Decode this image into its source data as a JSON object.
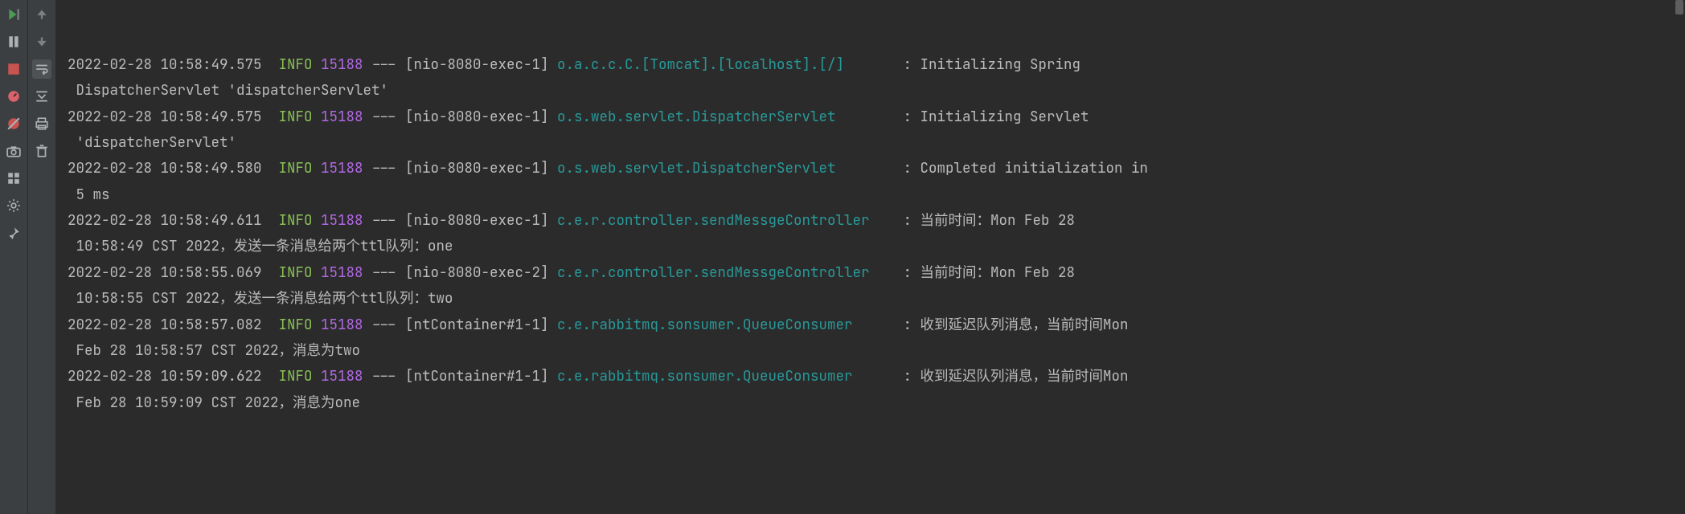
{
  "toolbar_left": {
    "resume": "resume",
    "pause": "pause",
    "stop": "stop",
    "profiler": "profiler",
    "mute_bp": "mute-breakpoints",
    "camera": "camera",
    "layout": "layout",
    "settings": "settings",
    "pin": "pin"
  },
  "toolbar_right": {
    "up": "up",
    "down": "down",
    "soft_wrap": "soft-wrap",
    "scroll_end": "scroll-to-end",
    "print": "print",
    "trash": "trash"
  },
  "log": [
    {
      "timestamp": "2022-02-28 10:58:49.575",
      "level": "INFO",
      "pid": "15188",
      "thread": "[nio-8080-exec-1]",
      "class": "o.a.c.c.C.[Tomcat].[localhost].[/]      ",
      "message": "Initializing Spring",
      "cont": "DispatcherServlet 'dispatcherServlet'"
    },
    {
      "timestamp": "2022-02-28 10:58:49.575",
      "level": "INFO",
      "pid": "15188",
      "thread": "[nio-8080-exec-1]",
      "class": "o.s.web.servlet.DispatcherServlet       ",
      "message": "Initializing Servlet",
      "cont": "'dispatcherServlet'"
    },
    {
      "timestamp": "2022-02-28 10:58:49.580",
      "level": "INFO",
      "pid": "15188",
      "thread": "[nio-8080-exec-1]",
      "class": "o.s.web.servlet.DispatcherServlet       ",
      "message": "Completed initialization in",
      "cont": "5 ms"
    },
    {
      "timestamp": "2022-02-28 10:58:49.611",
      "level": "INFO",
      "pid": "15188",
      "thread": "[nio-8080-exec-1]",
      "class": "c.e.r.controller.sendMessgeController   ",
      "message": "当前时间：Mon Feb 28",
      "cont": "10:58:49 CST 2022，发送一条消息给两个ttl队列：one"
    },
    {
      "timestamp": "2022-02-28 10:58:55.069",
      "level": "INFO",
      "pid": "15188",
      "thread": "[nio-8080-exec-2]",
      "class": "c.e.r.controller.sendMessgeController   ",
      "message": "当前时间：Mon Feb 28",
      "cont": "10:58:55 CST 2022，发送一条消息给两个ttl队列：two"
    },
    {
      "timestamp": "2022-02-28 10:58:57.082",
      "level": "INFO",
      "pid": "15188",
      "thread": "[ntContainer#1-1]",
      "class": "c.e.rabbitmq.sonsumer.QueueConsumer     ",
      "message": "收到延迟队列消息，当前时间Mon",
      "cont": "Feb 28 10:58:57 CST 2022，消息为two"
    },
    {
      "timestamp": "2022-02-28 10:59:09.622",
      "level": "INFO",
      "pid": "15188",
      "thread": "[ntContainer#1-1]",
      "class": "c.e.rabbitmq.sonsumer.QueueConsumer     ",
      "message": "收到延迟队列消息，当前时间Mon",
      "cont": "Feb 28 10:59:09 CST 2022，消息为one"
    }
  ]
}
